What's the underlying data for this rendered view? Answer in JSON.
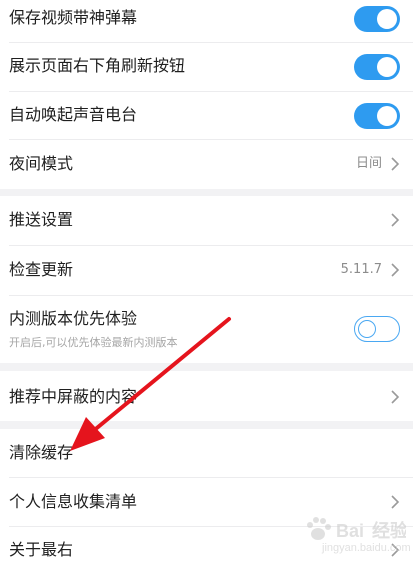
{
  "settings": {
    "danmaku": {
      "label": "保存视频带神弹幕",
      "enabled": true
    },
    "refresh_button": {
      "label": "展示页面右下角刷新按钮",
      "enabled": true
    },
    "radio": {
      "label": "自动唤起声音电台",
      "enabled": true
    },
    "night_mode": {
      "label": "夜间模式",
      "value": "日间"
    },
    "push": {
      "label": "推送设置"
    },
    "update": {
      "label": "检查更新",
      "value": "5.11.7"
    },
    "beta": {
      "label": "内测版本优先体验",
      "description": "开启后,可以优先体验最新内测版本",
      "enabled": false
    },
    "blocked": {
      "label": "推荐中屏蔽的内容"
    },
    "clear_cache": {
      "label": "清除缓存"
    },
    "personal_info": {
      "label": "个人信息收集清单"
    },
    "about": {
      "label": "关于最右"
    }
  },
  "watermark": {
    "text": "jingyan.baidu.com"
  },
  "colors": {
    "toggle_on": "#2e9bf0",
    "toggle_off_border": "#4aa8f2",
    "annotation_arrow": "#e5141d",
    "background": "#f2f2f4"
  },
  "icons": [
    "chevron-right-icon",
    "baidu-paw-icon"
  ]
}
